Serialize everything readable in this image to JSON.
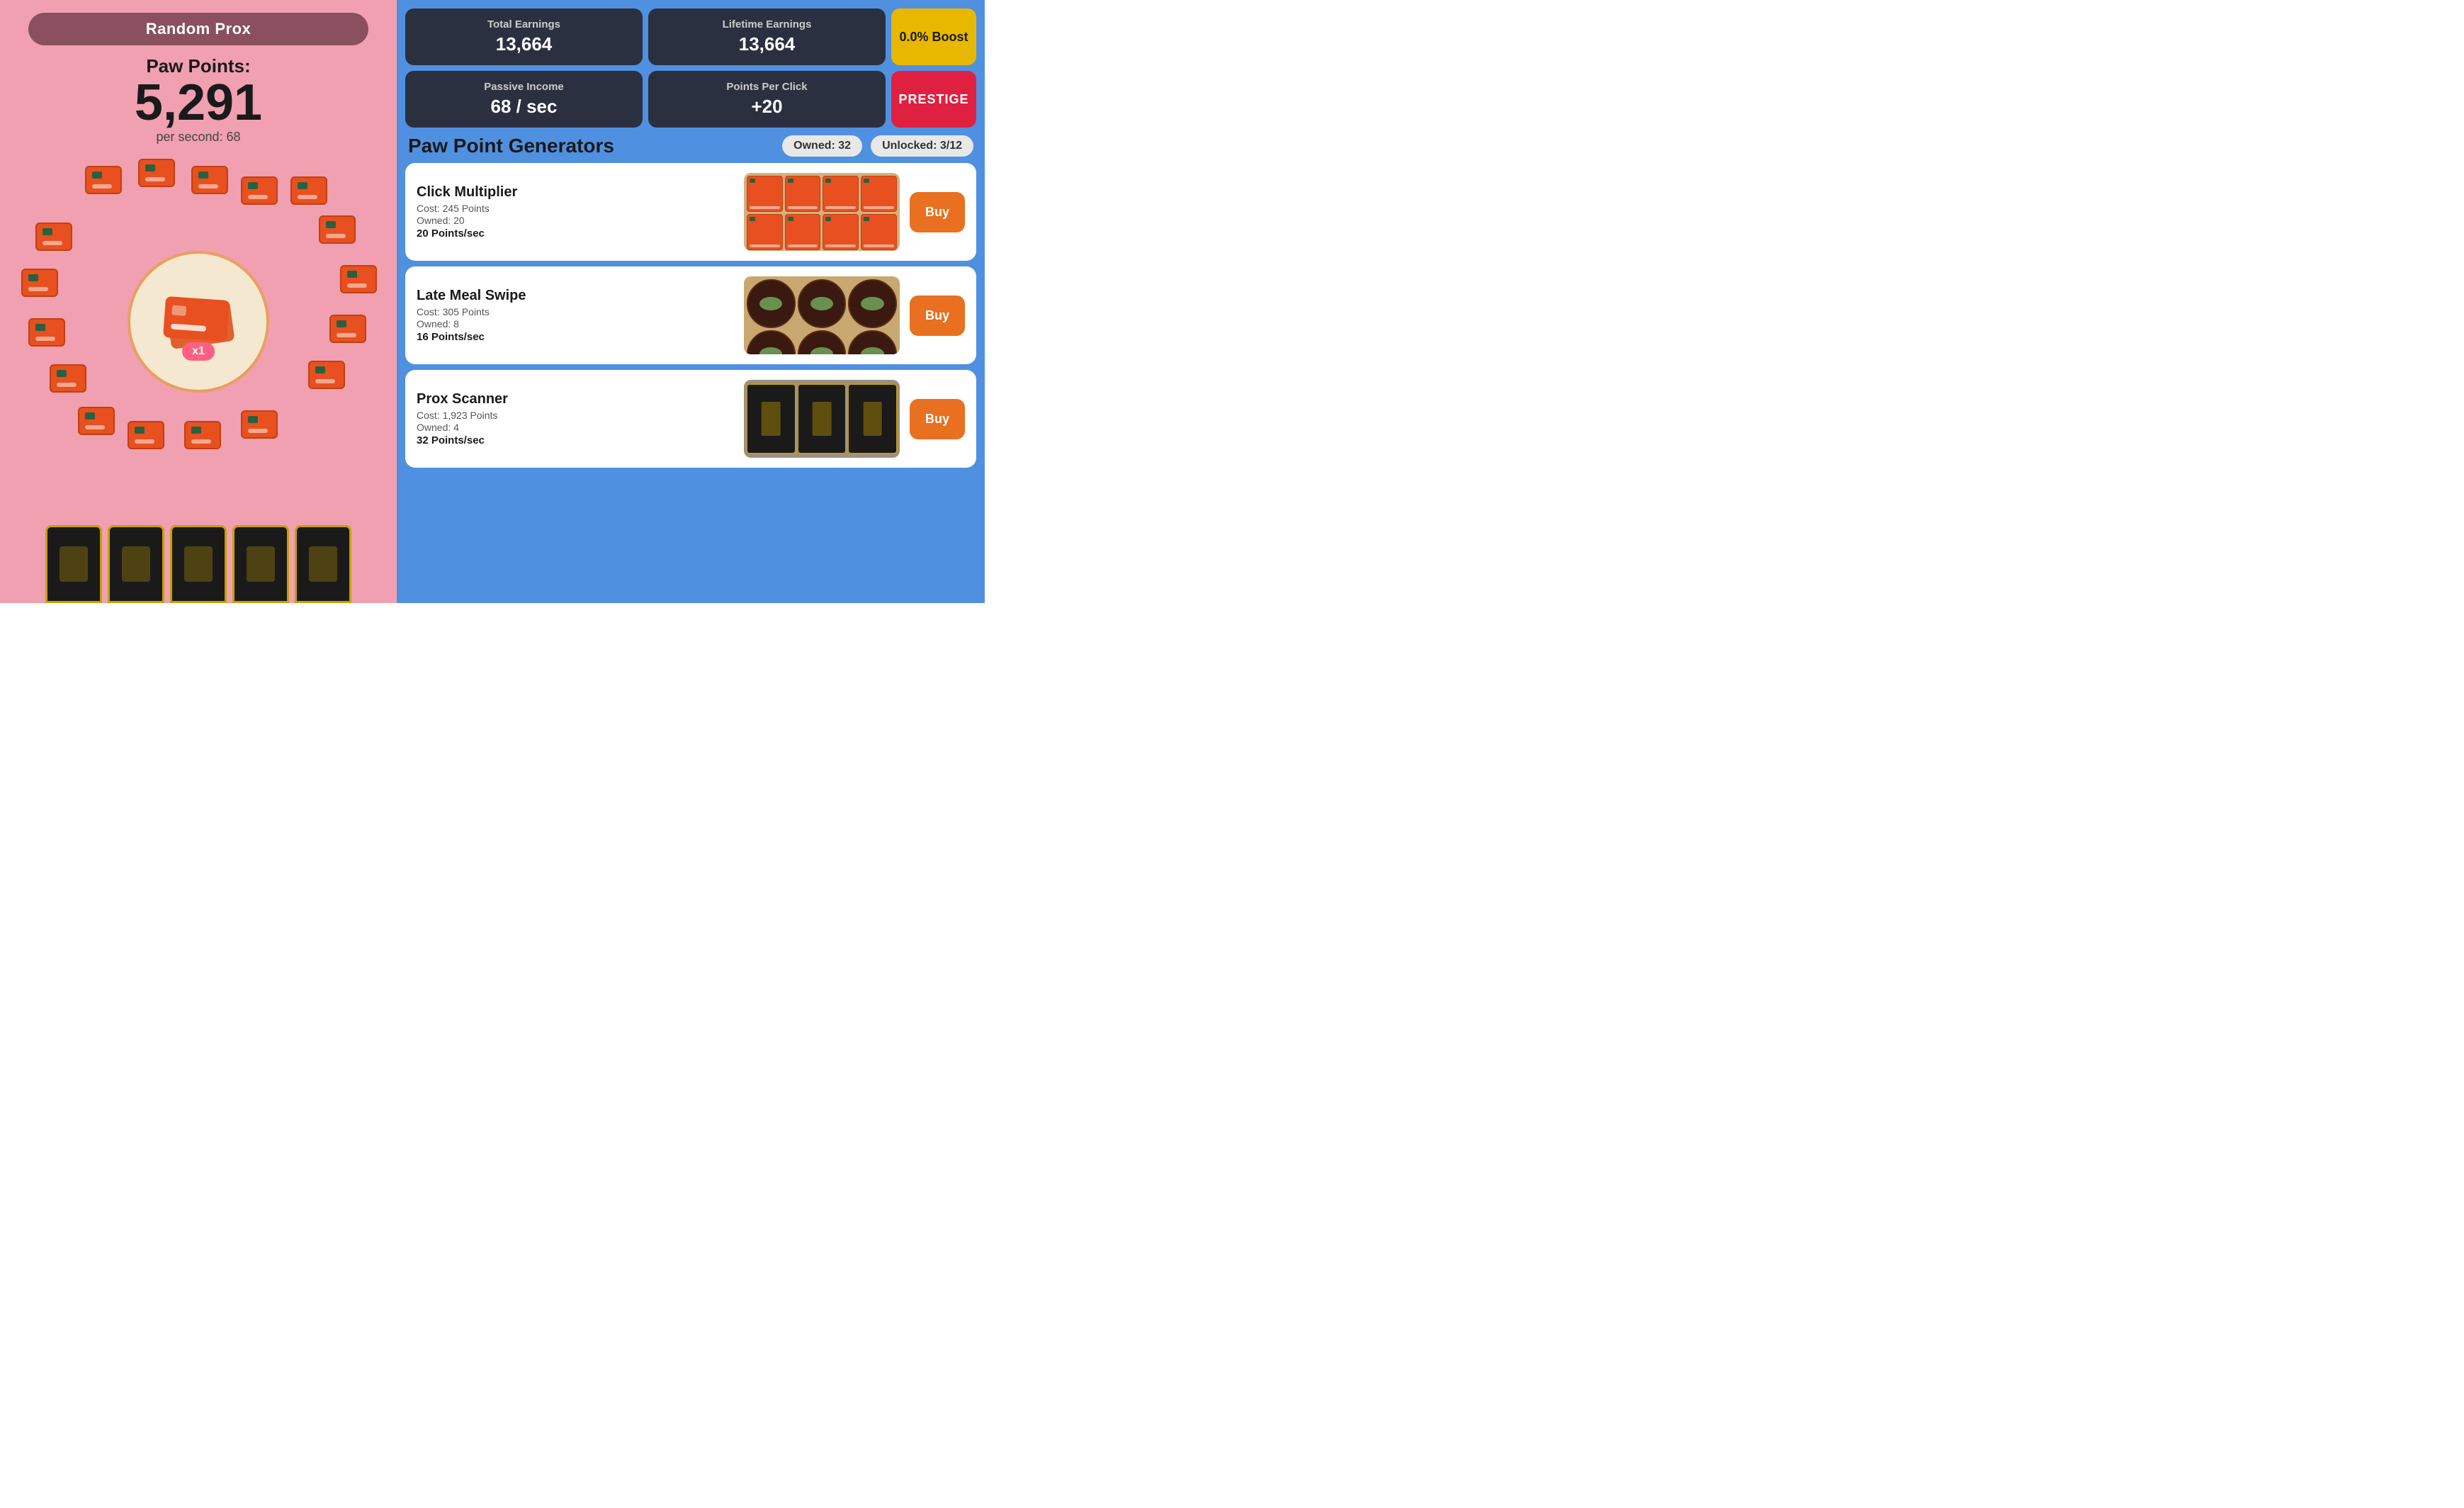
{
  "left": {
    "random_prox_label": "Random Prox",
    "paw_points_label": "Paw Points:",
    "paw_points_value": "5,291",
    "per_second_label": "per second: 68",
    "multiplier": "x1"
  },
  "stats": {
    "total_earnings_label": "Total Earnings",
    "total_earnings_value": "13,664",
    "lifetime_earnings_label": "Lifetime Earnings",
    "lifetime_earnings_value": "13,664",
    "passive_income_label": "Passive Income",
    "passive_income_value": "68 / sec",
    "points_per_click_label": "Points Per Click",
    "points_per_click_value": "+20",
    "boost_value": "0.0% Boost",
    "prestige_label": "PRESTIGE"
  },
  "generators": {
    "title": "Paw Point Generators",
    "owned_badge": "Owned: 32",
    "unlocked_badge": "Unlocked: 3/12",
    "items": [
      {
        "name": "Click Multiplier",
        "cost": "Cost: 245 Points",
        "owned": "Owned: 20",
        "rate": "20 Points/sec",
        "buy_label": "Buy",
        "type": "cards"
      },
      {
        "name": "Late Meal Swipe",
        "cost": "Cost: 305 Points",
        "owned": "Owned: 8",
        "rate": "16 Points/sec",
        "buy_label": "Buy",
        "type": "bowls"
      },
      {
        "name": "Prox Scanner",
        "cost": "Cost: 1,923 Points",
        "owned": "Owned: 4",
        "rate": "32 Points/sec",
        "buy_label": "Buy",
        "type": "scanners"
      }
    ]
  }
}
